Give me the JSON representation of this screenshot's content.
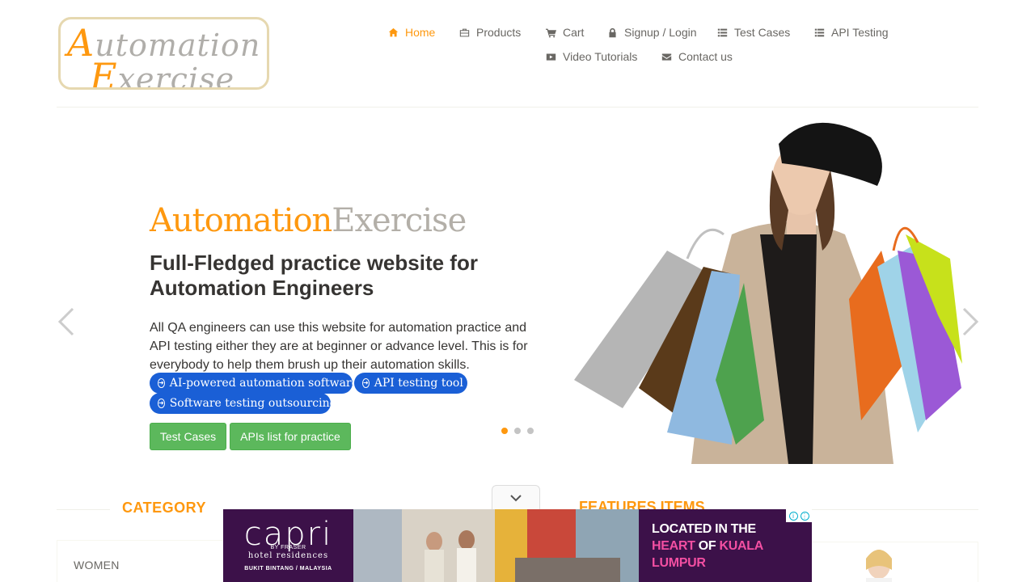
{
  "header": {
    "logo": {
      "line1_cap": "A",
      "line1_rest": "utomation",
      "line2_cap": "E",
      "line2_rest": "xercise"
    },
    "nav": [
      {
        "label": "Home",
        "icon": "home-icon",
        "active": true
      },
      {
        "label": "Products",
        "icon": "briefcase-icon"
      },
      {
        "label": "Cart",
        "icon": "cart-icon"
      },
      {
        "label": "Signup / Login",
        "icon": "lock-icon"
      },
      {
        "label": "Test Cases",
        "icon": "list-icon"
      },
      {
        "label": "API Testing",
        "icon": "list-icon"
      },
      {
        "label": "Video Tutorials",
        "icon": "youtube-play-icon"
      },
      {
        "label": "Contact us",
        "icon": "envelope-icon"
      }
    ]
  },
  "slider": {
    "title_part1": "Automation",
    "title_part2": "Exercise",
    "subtitle": "Full-Fledged practice website for Automation Engineers",
    "description": "All QA engineers can use this website for automation practice and API testing either they are at beginner or advance level. This is for everybody to help them brush up their automation skills.",
    "ad_links": [
      "AI-powered automation software",
      "API testing tool",
      "Software testing outsourcing"
    ],
    "buttons": [
      "Test Cases",
      "APIs list for practice"
    ],
    "dots": 3,
    "active_dot": 0
  },
  "sections": {
    "category_title": "CATEGORY",
    "features_title": "FEATURES ITEMS",
    "category_items": [
      "WOMEN"
    ]
  },
  "ad": {
    "brand": "capri",
    "brand_sub": "BY FRASER",
    "brand_line": "hotel residences",
    "location": "BUKIT BINTANG / MALAYSIA",
    "copy_line1": "LOCATED IN THE",
    "copy_line2_a": "HEART",
    "copy_line2_b": " OF ",
    "copy_line2_c": "KUALA",
    "copy_line3": "LUMPUR"
  },
  "colors": {
    "accent": "#fe980f",
    "text": "#696763",
    "dark": "#363432",
    "green": "#5cb85c",
    "ad_bg": "#3c1149",
    "ad_pink": "#f34fa2",
    "pill_blue": "#1a5fd6"
  }
}
